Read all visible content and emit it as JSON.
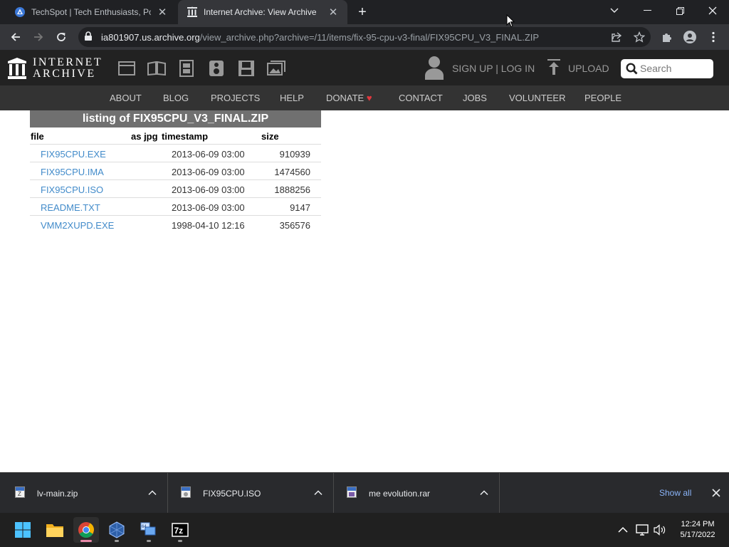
{
  "browser": {
    "tabs": [
      {
        "title": "TechSpot | Tech Enthusiasts, Pow",
        "active": false,
        "favicon": "techspot-icon"
      },
      {
        "title": "Internet Archive: View Archive",
        "active": true,
        "favicon": "archive-icon"
      }
    ],
    "url": {
      "host": "ia801907.us.archive.org",
      "path": "/view_archive.php?archive=/11/items/fix-95-cpu-v3-final/FIX95CPU_V3_FINAL.ZIP"
    }
  },
  "site": {
    "logo_line1": "INTERNET",
    "logo_line2": "ARCHIVE",
    "media_icons": [
      "web-icon",
      "texts-icon",
      "video-icon",
      "audio-icon",
      "software-icon",
      "images-icon"
    ],
    "signin": "SIGN UP | LOG IN",
    "upload": "UPLOAD",
    "search_placeholder": "Search",
    "nav": [
      "ABOUT",
      "BLOG",
      "PROJECTS",
      "HELP",
      "DONATE",
      "CONTACT",
      "JOBS",
      "VOLUNTEER",
      "PEOPLE"
    ],
    "donate_heart_color": "#e0383e"
  },
  "listing": {
    "title": "listing of FIX95CPU_V3_FINAL.ZIP",
    "columns": {
      "file": "file",
      "as_jpg": "as jpg",
      "timestamp": "timestamp",
      "size": "size"
    },
    "rows": [
      {
        "file": "FIX95CPU.EXE",
        "timestamp": "2013-06-09 03:00",
        "size": "910939"
      },
      {
        "file": "FIX95CPU.IMA",
        "timestamp": "2013-06-09 03:00",
        "size": "1474560"
      },
      {
        "file": "FIX95CPU.ISO",
        "timestamp": "2013-06-09 03:00",
        "size": "1888256"
      },
      {
        "file": "README.TXT",
        "timestamp": "2013-06-09 03:00",
        "size": "9147"
      },
      {
        "file": "VMM2XUPD.EXE",
        "timestamp": "1998-04-10 12:16",
        "size": "356576"
      }
    ]
  },
  "downloads": {
    "items": [
      {
        "name": "lv-main.zip",
        "icon": "zip-file-icon"
      },
      {
        "name": "FIX95CPU.ISO",
        "icon": "iso-file-icon"
      },
      {
        "name": "me evolution.rar",
        "icon": "rar-file-icon"
      }
    ],
    "show_all": "Show all"
  },
  "taskbar": {
    "apps": [
      "windows-start-icon",
      "file-explorer-icon",
      "chrome-icon",
      "virtualbox-icon",
      "vmware-icon",
      "7zip-icon"
    ],
    "time": "12:24 PM",
    "date": "5/17/2022"
  }
}
